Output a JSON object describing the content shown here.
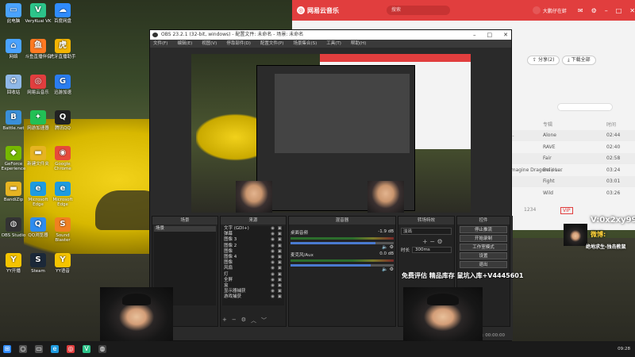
{
  "desktop_icons": [
    {
      "label": "此电脑",
      "icon": "computer-icon",
      "color": "#4aa3ff"
    },
    {
      "label": "VeryKuai VK",
      "icon": "vk-icon",
      "color": "#2cc48a"
    },
    {
      "label": "百度网盘",
      "icon": "cloud-icon",
      "color": "#2f8cff"
    },
    {
      "label": "网络",
      "icon": "network-icon",
      "color": "#4aa3ff"
    },
    {
      "label": "斗鱼直播伴侣",
      "icon": "douyu-icon",
      "color": "#ff7a22"
    },
    {
      "label": "虎牙直播助手",
      "icon": "huya-icon",
      "color": "#f3b400"
    },
    {
      "label": "回收站",
      "icon": "recycle-bin-icon",
      "color": "#8fb8e8"
    },
    {
      "label": "网易云音乐",
      "icon": "netease-music-icon",
      "color": "#e13e3e"
    },
    {
      "label": "迅游加速",
      "icon": "gamespeed-icon",
      "color": "#2a7df0"
    },
    {
      "label": "Battle.net",
      "icon": "battlenet-icon",
      "color": "#3a8fd8"
    },
    {
      "label": "网游加速器",
      "icon": "accelerator-icon",
      "color": "#22c055"
    },
    {
      "label": "腾讯QQ",
      "icon": "qq-icon",
      "color": "#222222"
    },
    {
      "label": "GeForce Experience",
      "icon": "geforce-icon",
      "color": "#76b900"
    },
    {
      "label": "新建文件夹",
      "icon": "folder-icon",
      "color": "#e6b422"
    },
    {
      "label": "Google Chrome",
      "icon": "chrome-icon",
      "color": "#e64a3a"
    },
    {
      "label": "BandiZip",
      "icon": "folder-icon",
      "color": "#e6b422"
    },
    {
      "label": "Microsoft Edge",
      "icon": "edge-icon",
      "color": "#1e9be0"
    },
    {
      "label": "Microsoft Edge",
      "icon": "edge-icon",
      "color": "#1e9be0"
    },
    {
      "label": "OBS Studio",
      "icon": "obs-icon",
      "color": "#333333"
    },
    {
      "label": "QQ浏览器",
      "icon": "qq-browser-icon",
      "color": "#2d8cf0"
    },
    {
      "label": "Sound Blaster",
      "icon": "soundblaster-icon",
      "color": "#f08020"
    },
    {
      "label": "YY开播",
      "icon": "yy-icon",
      "color": "#f5c400"
    },
    {
      "label": "Steam",
      "icon": "steam-icon",
      "color": "#1b2838"
    },
    {
      "label": "YY语音",
      "icon": "yy-voice-icon",
      "color": "#f5c400"
    }
  ],
  "music_app": {
    "brand": "网易云音乐",
    "search_placeholder": "搜索",
    "user_name": "大鹏仔在蚌",
    "share_label": "分享(2)",
    "download_label": "下载全部",
    "col_album": "专辑",
    "col_time": "时间",
    "rows": [
      {
        "title": "...",
        "album": "Alone",
        "time": "02:44"
      },
      {
        "title": "",
        "album": "RAVE",
        "time": "02:40"
      },
      {
        "title": "",
        "album": "Fair",
        "time": "02:58"
      },
      {
        "title": "Imagine Dragons / L...",
        "album": "Believer",
        "time": "03:24"
      },
      {
        "title": "",
        "album": "Fight",
        "time": "03:01"
      },
      {
        "title": "",
        "album": "Wild",
        "time": "03:26"
      }
    ],
    "footer_badge": "VIP",
    "footer_count": "1234"
  },
  "obs": {
    "title": "OBS 23.2.1 (32-bit, windows) - 配置文件: 未命名 - 场景: 未命名",
    "menu": [
      "文件(F)",
      "编辑(E)",
      "视图(V)",
      "停靠部件(D)",
      "配置文件(P)",
      "场景集合(S)",
      "工具(T)",
      "帮助(H)"
    ],
    "docks": {
      "scenes": "场景",
      "sources": "来源",
      "mixer": "混音器",
      "transitions": "转场特效",
      "controls": "控件"
    },
    "scenes_list": [
      "场景"
    ],
    "sources_list": [
      "文字 (GDI+)",
      "弹幕",
      "图像 3",
      "图像 2",
      "图像",
      "图像 4",
      "图像",
      "风扇",
      "灯",
      "全屏",
      "盒",
      "显示器捕获",
      "游戏捕获"
    ],
    "mixer": [
      {
        "name": "桌面音频",
        "db": "-1.9 dB",
        "level": 0.82
      },
      {
        "name": "麦克风/Aux",
        "db": "0.0 dB",
        "level": 0.78
      }
    ],
    "transition": {
      "type": "淡出",
      "duration_label": "时长",
      "duration": "300ms"
    },
    "controls": [
      "停止推流",
      "开始录制",
      "工作室模式",
      "设置",
      "退出"
    ],
    "status": "LIVE: 00:00:00"
  },
  "overlay": {
    "promo_text": "免费评估 精品库存 鼠坑入库+V4445601",
    "right_text1": "V:0x2xy99",
    "right_text2": "微博:",
    "right_text3": "绝地求生-独击教鼠"
  },
  "taskbar": {
    "clock": "09:28",
    "apps": [
      "windows-icon",
      "search-icon",
      "taskview-icon",
      "edge-icon",
      "netease-music-icon",
      "vk-icon",
      "obs-icon"
    ]
  }
}
